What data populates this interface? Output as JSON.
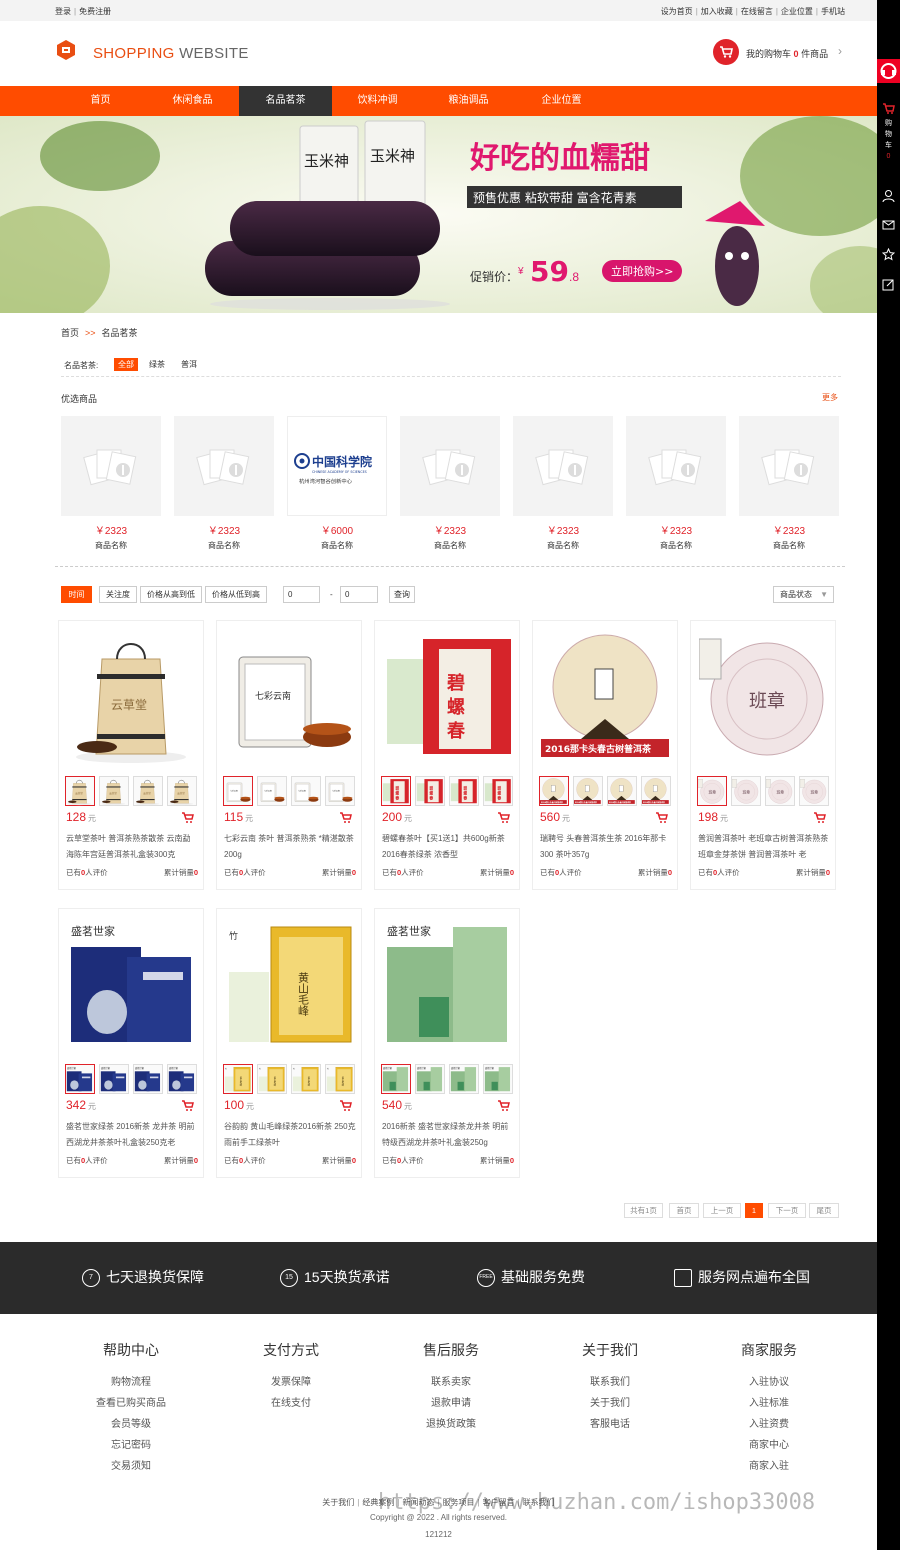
{
  "topbar": {
    "login": "登录",
    "register": "免费注册",
    "links": [
      "设为首页",
      "加入收藏",
      "在线留言",
      "企业位置",
      "手机站"
    ]
  },
  "logo": {
    "brand1": "SHOPPING",
    "brand2": "WEBSITE"
  },
  "cart": {
    "prefix": "我的购物车",
    "count": "0",
    "suffix": "件商品"
  },
  "sidebar": {
    "cart_label": "购物车",
    "cart_count": "0"
  },
  "nav": [
    "首页",
    "休闲食品",
    "名品茗茶",
    "饮料冲调",
    "粮油调品",
    "企业位置"
  ],
  "nav_active_index": 2,
  "banner": {
    "product_label": "玉米神",
    "headline": "好吃的血糯甜",
    "tags": "预售优惠  粘软带甜  富含花青素",
    "price_label": "促销价：",
    "currency": "¥",
    "price_main": "59",
    "price_dec": ".8",
    "cta": "立即抢购>>"
  },
  "breadcrumb": {
    "home": "首页",
    "arrow": ">>",
    "current": "名品茗茶"
  },
  "filter": {
    "label": "名品茗茶:",
    "options": [
      "全部",
      "绿茶",
      "普洱"
    ],
    "active_index": 0
  },
  "featured": {
    "title": "优选商品",
    "more": "更多",
    "items": [
      {
        "price": "￥2323",
        "name": "商品名称",
        "img": "placeholder"
      },
      {
        "price": "￥2323",
        "name": "商品名称",
        "img": "placeholder"
      },
      {
        "price": "￥6000",
        "name": "商品名称",
        "img": "cas-logo",
        "logo_cn": "中国科学院",
        "logo_en": "CHINESE ACADEMY OF SCIENCES",
        "logo_sub": "杭州湾河智谷创新中心"
      },
      {
        "price": "￥2323",
        "name": "商品名称",
        "img": "placeholder"
      },
      {
        "price": "￥2323",
        "name": "商品名称",
        "img": "placeholder"
      },
      {
        "price": "￥2323",
        "name": "商品名称",
        "img": "placeholder"
      },
      {
        "price": "￥2323",
        "name": "商品名称",
        "img": "placeholder"
      }
    ]
  },
  "sortbar": {
    "buttons": [
      "时间",
      "关注度",
      "价格从高到低",
      "价格从低到高"
    ],
    "active_index": 0,
    "min_value": "0",
    "dash": "-",
    "max_value": "0",
    "query": "查询",
    "status": "商品状态"
  },
  "products": [
    {
      "price": "128",
      "unit": "元",
      "title": "云草堂茶叶 普洱茶熟茶散茶 云南勐海陈年宫廷普洱茶礼盒装300克",
      "reviews_pre": "已有",
      "reviews": "0",
      "reviews_suf": "人评价",
      "sold_pre": "累计销量",
      "sold": "0",
      "img": "barrel",
      "img_text": "云草堂"
    },
    {
      "price": "115",
      "unit": "元",
      "title": "七彩云南 茶叶 普洱茶熟茶 *精湛散茶 200g",
      "reviews_pre": "已有",
      "reviews": "0",
      "reviews_suf": "人评价",
      "sold_pre": "累计销量",
      "sold": "0",
      "img": "tin",
      "img_text": "七彩云南"
    },
    {
      "price": "200",
      "unit": "元",
      "title": "碧螺春茶叶【买1送1】共600g新茶2016春茶绿茶 浓香型",
      "reviews_pre": "已有",
      "reviews": "0",
      "reviews_suf": "人评价",
      "sold_pre": "累计销量",
      "sold": "0",
      "img": "biluochun",
      "img_text": "碧螺春"
    },
    {
      "price": "560",
      "unit": "元",
      "title": "瑞聘号 头春普洱茶生茶 2016年那卡300 茶叶357g",
      "reviews_pre": "已有",
      "reviews": "0",
      "reviews_suf": "人评价",
      "sold_pre": "累计销量",
      "sold": "0",
      "img": "cake",
      "img_text": "2016那卡头春古树普洱茶"
    },
    {
      "price": "198",
      "unit": "元",
      "title": "普润普洱茶叶 老班章古树普洱茶熟茶班章金芽茶饼 普润普洱茶叶 老",
      "reviews_pre": "已有",
      "reviews": "0",
      "reviews_suf": "人评价",
      "sold_pre": "累计销量",
      "sold": "0",
      "img": "cake2",
      "img_text": "班章"
    },
    {
      "price": "342",
      "unit": "元",
      "title": "盛茗世家绿茶 2016新茶 龙井茶 明前西湖龙井茶茶叶礼盒装250克老",
      "reviews_pre": "已有",
      "reviews": "0",
      "reviews_suf": "人评价",
      "sold_pre": "累计销量",
      "sold": "0",
      "img": "bluebox",
      "img_text": "盛茗世家"
    },
    {
      "price": "100",
      "unit": "元",
      "title": "谷韵韵 黄山毛峰绿茶2016新茶 250克 雨前手工绿茶叶",
      "reviews_pre": "已有",
      "reviews": "0",
      "reviews_suf": "人评价",
      "sold_pre": "累计销量",
      "sold": "0",
      "img": "yellowtin",
      "img_text": "黄山毛峰"
    },
    {
      "price": "540",
      "unit": "元",
      "title": "2016新茶 盛茗世家绿茶龙井茶 明前特级西湖龙井茶叶礼盒装250g",
      "reviews_pre": "已有",
      "reviews": "0",
      "reviews_suf": "人评价",
      "sold_pre": "累计销量",
      "sold": "0",
      "img": "greenbox",
      "img_text": "盛茗世家"
    }
  ],
  "pager": {
    "total": "共有1页",
    "first": "首页",
    "prev": "上一页",
    "current": "1",
    "next": "下一页",
    "last": "尾页"
  },
  "services": [
    {
      "icon": "7",
      "text": "七天退换货保障"
    },
    {
      "icon": "15",
      "text": "15天换货承诺"
    },
    {
      "icon": "FREE",
      "text": "基础服务免费"
    },
    {
      "icon": "map",
      "text": "服务网点遍布全国"
    }
  ],
  "footer": [
    {
      "title": "帮助中心",
      "links": [
        "购物流程",
        "查看已购买商品",
        "会员等级",
        "忘记密码",
        "交易须知"
      ]
    },
    {
      "title": "支付方式",
      "links": [
        "发票保障",
        "在线支付"
      ]
    },
    {
      "title": "售后服务",
      "links": [
        "联系卖家",
        "退款申请",
        "退换货政策"
      ]
    },
    {
      "title": "关于我们",
      "links": [
        "联系我们",
        "关于我们",
        "客服电话"
      ]
    },
    {
      "title": "商家服务",
      "links": [
        "入驻协议",
        "入驻标准",
        "入驻资费",
        "商家中心",
        "商家入驻"
      ]
    }
  ],
  "footer_links": [
    "关于我们",
    "经典案例",
    "新闻动态",
    "服务项目",
    "客户留言",
    "联系我们"
  ],
  "copyright": "Copyright @ 2022 . All rights reserved.",
  "icp": "121212",
  "watermark": "https://www.huzhan.com/ishop33008"
}
